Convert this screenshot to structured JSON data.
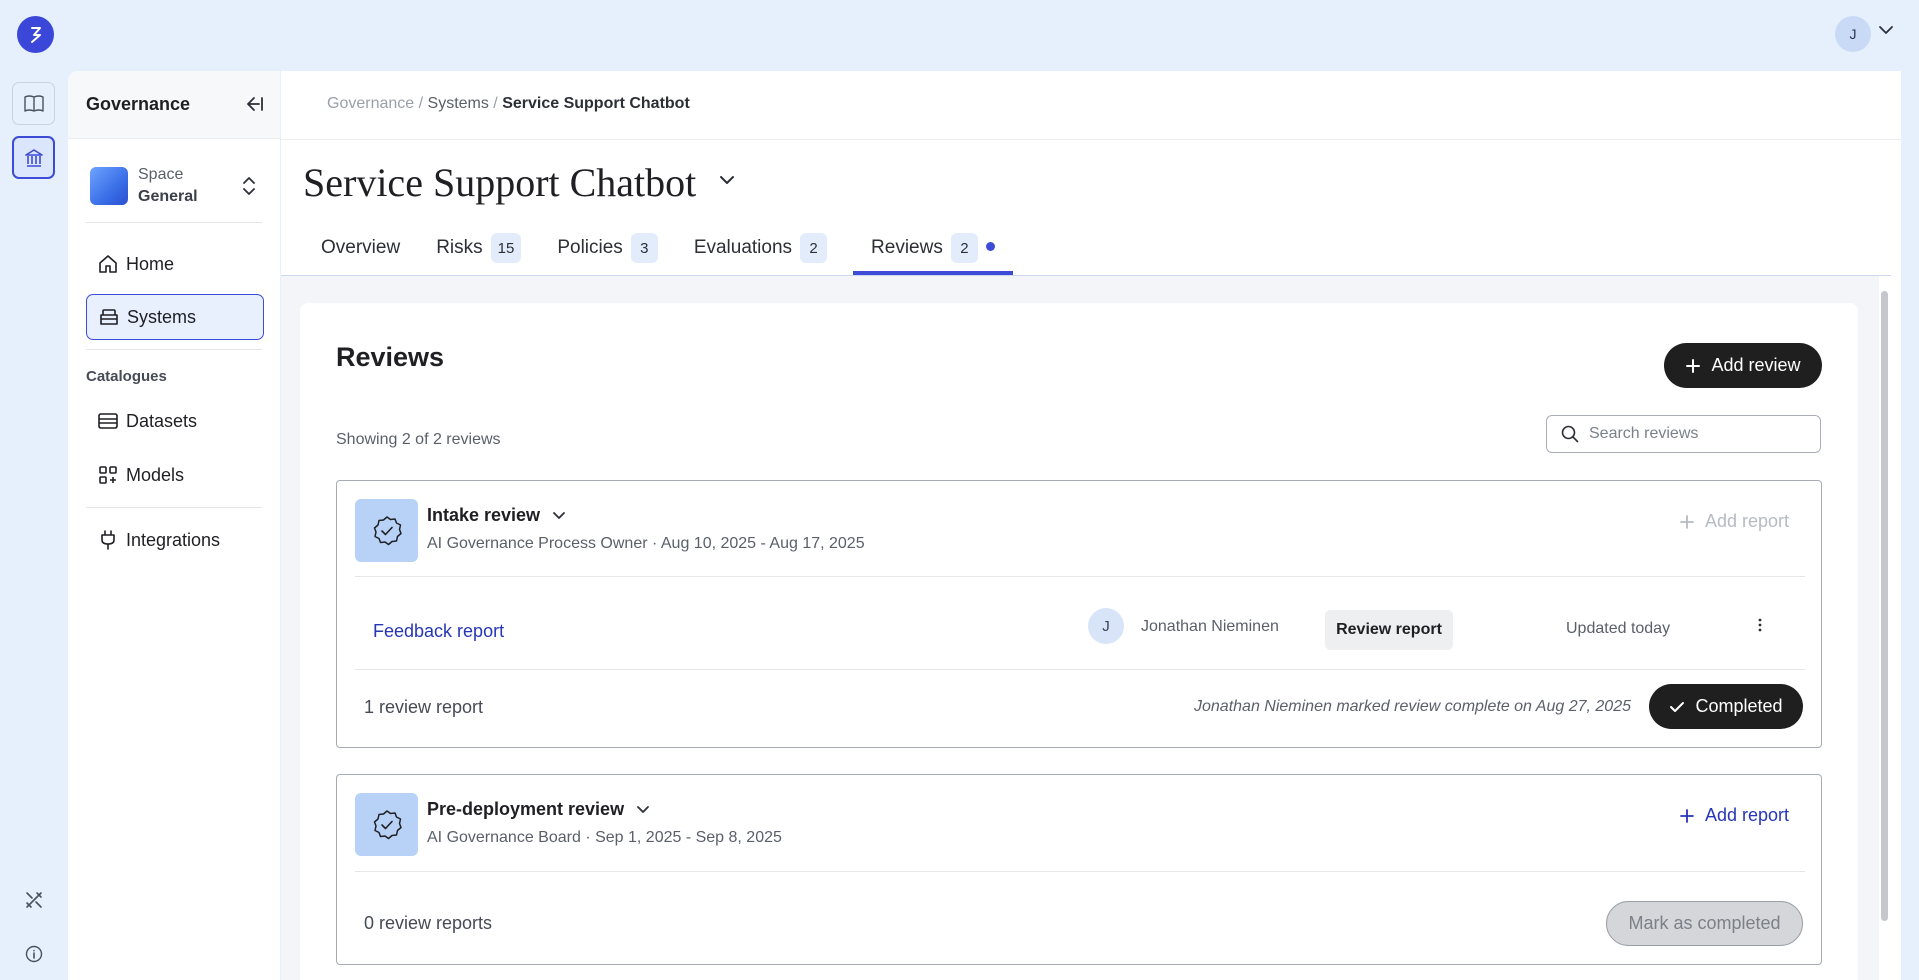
{
  "app": {
    "user_initial": "J"
  },
  "sidebar": {
    "title": "Governance",
    "space": {
      "label": "Space",
      "value": "General"
    },
    "nav": [
      {
        "label": "Home",
        "icon": "home-icon"
      },
      {
        "label": "Systems",
        "icon": "systems-icon"
      }
    ],
    "section_label": "Catalogues",
    "catalogues": [
      {
        "label": "Datasets",
        "icon": "datasets-icon"
      },
      {
        "label": "Models",
        "icon": "models-icon"
      }
    ],
    "integrations": {
      "label": "Integrations",
      "icon": "plug-icon"
    }
  },
  "breadcrumb": {
    "root": "Governance",
    "sep1": " / ",
    "mid": "Systems",
    "sep2": " / ",
    "current": "Service Support Chatbot"
  },
  "page": {
    "title": "Service Support Chatbot"
  },
  "tabs": [
    {
      "label": "Overview",
      "count": null
    },
    {
      "label": "Risks",
      "count": "15"
    },
    {
      "label": "Policies",
      "count": "3"
    },
    {
      "label": "Evaluations",
      "count": "2"
    },
    {
      "label": "Reviews",
      "count": "2"
    }
  ],
  "reviews": {
    "heading": "Reviews",
    "add_button": "Add review",
    "showing": "Showing 2 of 2 reviews",
    "search_placeholder": "Search reviews",
    "items": [
      {
        "name": "Intake review",
        "meta": "AI Governance Process Owner · Aug 10, 2025 - Aug 17, 2025",
        "add_report": "Add report",
        "report": {
          "title": "Feedback report",
          "reviewer_initial": "J",
          "reviewer": "Jonathan Nieminen",
          "action": "Review report",
          "updated": "Updated today"
        },
        "count": "1 review report",
        "completion_note": "Jonathan Nieminen marked review complete on Aug 27, 2025",
        "status_button": "Completed"
      },
      {
        "name": "Pre-deployment review",
        "meta": "AI Governance Board · Sep 1, 2025 - Sep 8, 2025",
        "add_report": "Add report",
        "count": "0 review reports",
        "status_button": "Mark as completed"
      }
    ]
  },
  "colors": {
    "accent": "#3d4cd6",
    "link": "#2636b6",
    "background": "#e6effc",
    "dark_button": "#1f1f1f"
  }
}
